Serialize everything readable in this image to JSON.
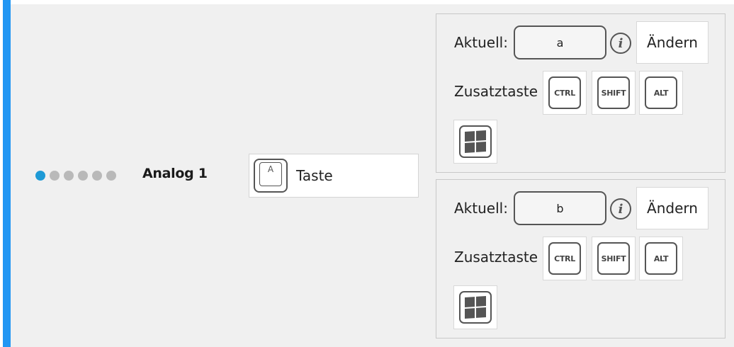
{
  "colors": {
    "accent": "#2196f3",
    "active_dot": "#1e9ad6",
    "inactive_dot": "#b9b9b9"
  },
  "row": {
    "position_dots_total": 6,
    "position_dots_active_index": 0,
    "channel_name": "Analog 1"
  },
  "mode": {
    "icon": "keyboard-key-icon",
    "icon_letter": "A",
    "label": "Taste"
  },
  "key_panels": [
    {
      "current_label": "Aktuell:",
      "current_value": "a",
      "info_icon": "info-icon",
      "change_label": "Ändern",
      "modifier_label": "Zusatztaste",
      "modifiers": {
        "ctrl": "CTRL",
        "shift": "SHIFT",
        "alt": "ALT",
        "win": "windows-icon"
      }
    },
    {
      "current_label": "Aktuell:",
      "current_value": "b",
      "info_icon": "info-icon",
      "change_label": "Ändern",
      "modifier_label": "Zusatztaste",
      "modifiers": {
        "ctrl": "CTRL",
        "shift": "SHIFT",
        "alt": "ALT",
        "win": "windows-icon"
      }
    }
  ]
}
